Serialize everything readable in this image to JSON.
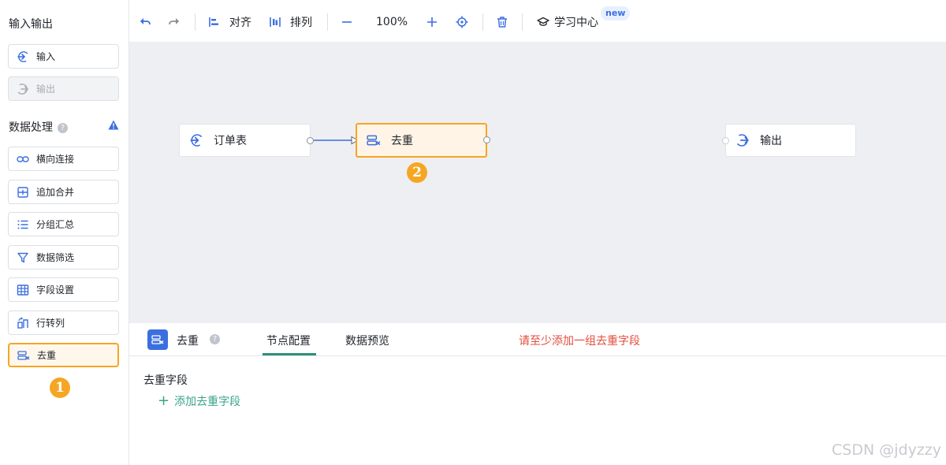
{
  "sidebar": {
    "io_title": "输入输出",
    "io_items": [
      {
        "label": "输入",
        "icon": "input-icon",
        "disabled": false
      },
      {
        "label": "输出",
        "icon": "output-icon",
        "disabled": true
      }
    ],
    "proc_title": "数据处理",
    "proc_items": [
      {
        "label": "横向连接",
        "icon": "link-icon"
      },
      {
        "label": "追加合并",
        "icon": "merge-icon"
      },
      {
        "label": "分组汇总",
        "icon": "list-icon"
      },
      {
        "label": "数据筛选",
        "icon": "filter-icon"
      },
      {
        "label": "字段设置",
        "icon": "table-icon"
      },
      {
        "label": "行转列",
        "icon": "pivot-icon"
      },
      {
        "label": "去重",
        "icon": "dedup-icon",
        "selected": true
      }
    ],
    "step_badge": "1"
  },
  "toolbar": {
    "align_label": "对齐",
    "arrange_label": "排列",
    "zoom": "100%",
    "learn_label": "学习中心",
    "new_tag": "new"
  },
  "canvas": {
    "nodes": [
      {
        "label": "订单表",
        "icon": "input-icon"
      },
      {
        "label": "去重",
        "icon": "dedup-icon",
        "selected": true
      },
      {
        "label": "输出",
        "icon": "output-icon"
      }
    ],
    "step_badge": "2"
  },
  "panel": {
    "title": "去重",
    "tabs": [
      "节点配置",
      "数据预览"
    ],
    "active_tab": "节点配置",
    "warning": "请至少添加一组去重字段",
    "field_label": "去重字段",
    "add_label": "添加去重字段"
  },
  "watermark": "CSDN @jdyzzy",
  "colors": {
    "accent": "#3b6fe0",
    "highlight": "#f5a623",
    "tab_active": "#2e8f78",
    "error": "#e34d3c",
    "link": "#3aa389"
  }
}
